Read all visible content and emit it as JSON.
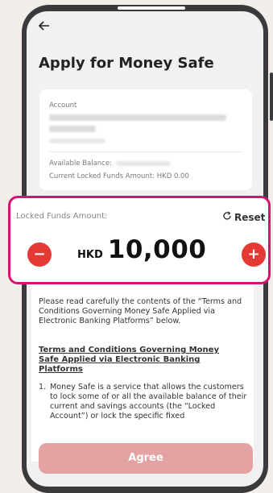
{
  "header": {
    "back_icon": "arrow-left-icon",
    "title": "Apply for Money Safe"
  },
  "account": {
    "label": "Account",
    "available_balance_label": "Available Balance:",
    "current_locked_label": "Current Locked Funds Amount: HKD 0.00"
  },
  "locked_funds": {
    "label": "Locked Funds Amount:",
    "reset_label": "Reset",
    "reset_icon": "refresh-icon",
    "currency": "HKD",
    "amount": "10,000",
    "minus_icon": "minus-icon",
    "plus_icon": "plus-icon",
    "minus_symbol": "−",
    "plus_symbol": "+"
  },
  "terms": {
    "intro": "Please read carefully the contents of the “Terms and Conditions Governing Money Safe Applied via Electronic Banking Platforms” below.",
    "title": "Terms and Conditions Governing Money Safe Applied via Electronic Banking Platforms",
    "item1_num": "1.",
    "item1_text": "Money Safe is a service that allows the customers to lock some of or all the available balance of their current and savings accounts (the “Locked Account”) or lock the specific fixed"
  },
  "footer": {
    "agree_label": "Agree"
  },
  "colors": {
    "accent": "#d4146f",
    "button_red": "#e53935",
    "agree_disabled": "#e3a3a2"
  }
}
